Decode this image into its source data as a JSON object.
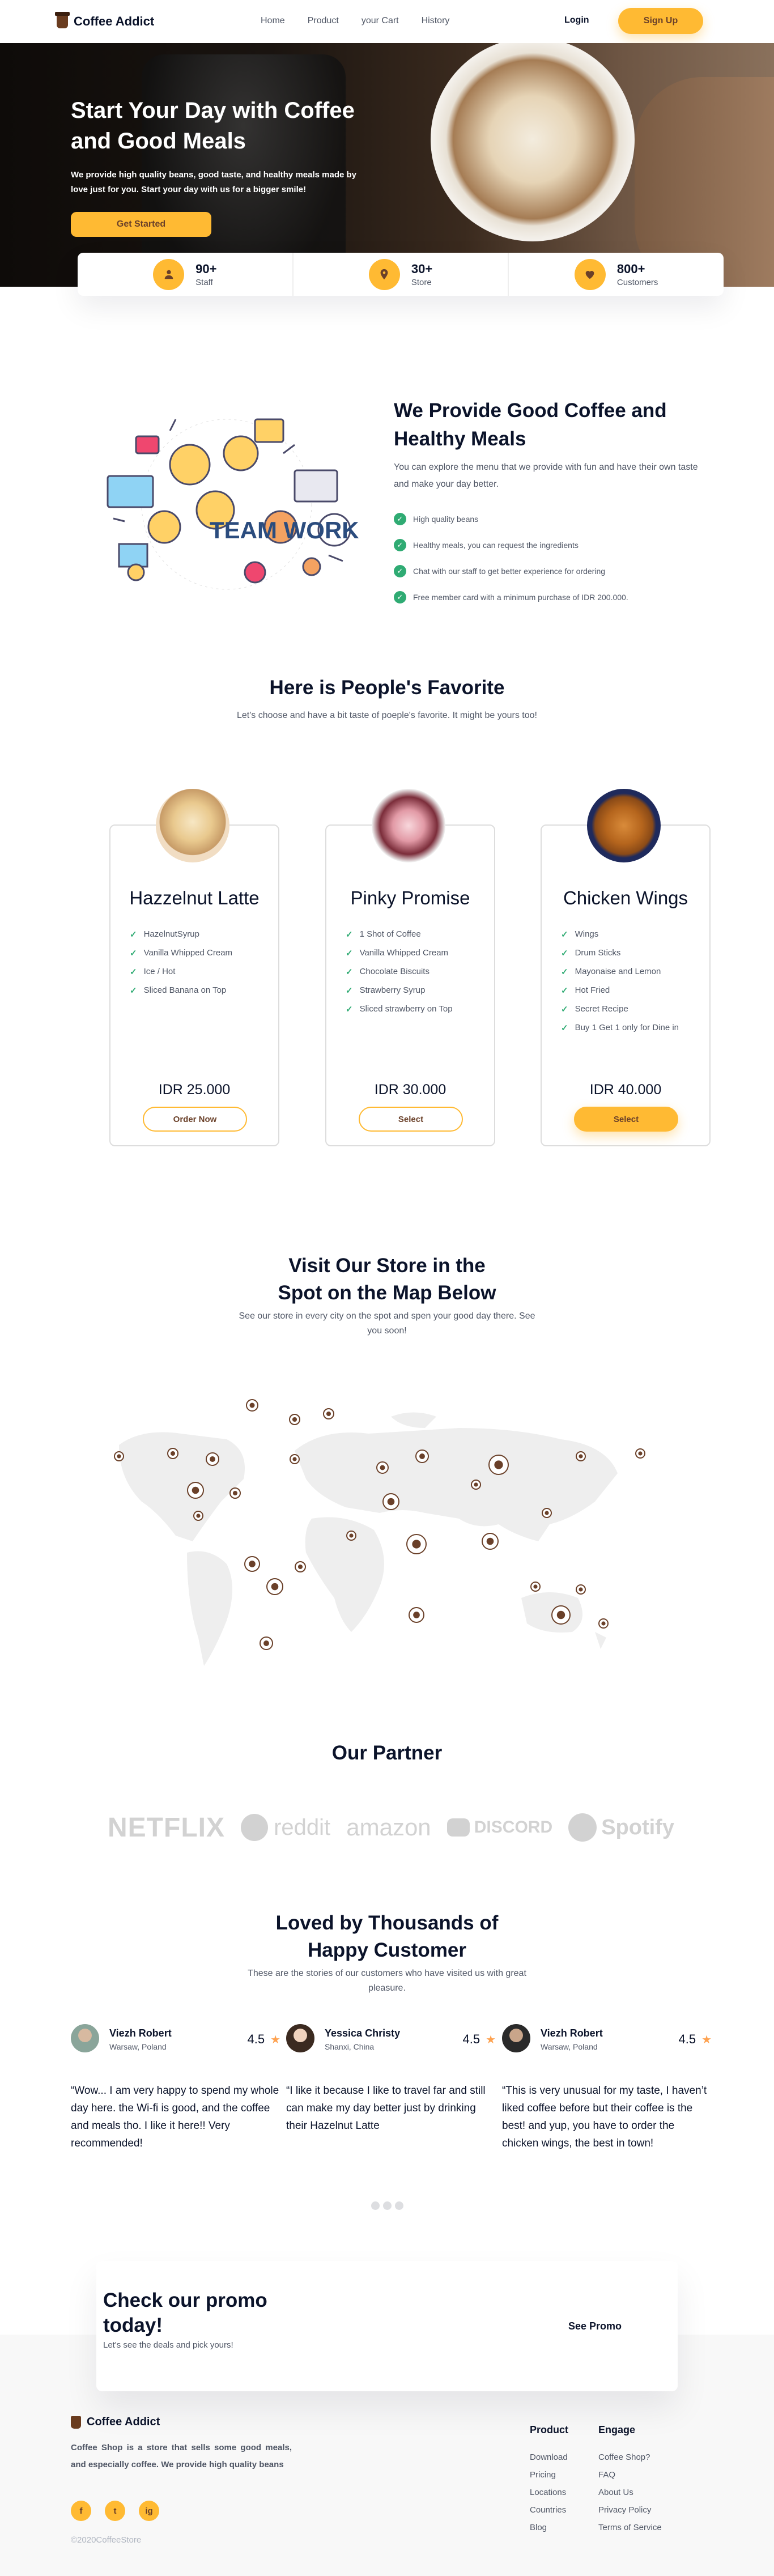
{
  "nav": {
    "brand": "Coffee Addict",
    "links": [
      "Home",
      "Product",
      "your Cart",
      "History"
    ],
    "login": "Login",
    "signup": "Sign Up"
  },
  "hero": {
    "title": "Start Your Day with Coffee and Good Meals",
    "desc": "We provide high quality beans, good taste, and healthy meals made by love just for you. Start your day with us for a bigger smile!",
    "cta": "Get Started"
  },
  "stats": [
    {
      "icon": "user-icon",
      "value": "90+",
      "label": "Staff"
    },
    {
      "icon": "location-pin-icon",
      "value": "30+",
      "label": "Store"
    },
    {
      "icon": "heart-icon",
      "value": "800+",
      "label": "Customers"
    }
  ],
  "about": {
    "illustration_text": "TEAM WORK",
    "title": "We Provide Good Coffee and Healthy Meals",
    "desc": "You can explore the menu that we provide with fun and have their own taste and make your day better.",
    "points": [
      "High quality beans",
      "Healthy meals, you can request the ingredients",
      "Chat with our staff to get better experience for ordering",
      "Free member card with a minimum purchase of IDR 200.000."
    ]
  },
  "favorites": {
    "title": "Here is People's Favorite",
    "subtitle": "Let's choose and have a bit taste of poeple's favorite. It might be yours too!",
    "items": [
      {
        "name": "Hazzelnut Latte",
        "features": [
          "HazelnutSyrup",
          "Vanilla Whipped Cream",
          "Ice / Hot",
          "Sliced Banana on Top"
        ],
        "price": "IDR 25.000",
        "button": "Order Now"
      },
      {
        "name": "Pinky Promise",
        "features": [
          "1 Shot of Coffee",
          "Vanilla Whipped Cream",
          "Chocolate Biscuits",
          "Strawberry Syrup",
          "Sliced strawberry on Top"
        ],
        "price": "IDR 30.000",
        "button": "Select"
      },
      {
        "name": "Chicken Wings",
        "features": [
          "Wings",
          "Drum Sticks",
          "Mayonaise and Lemon",
          "Hot Fried",
          "Secret Recipe",
          "Buy 1 Get 1 only for Dine in"
        ],
        "price": "IDR 40.000",
        "button": "Select"
      }
    ]
  },
  "map": {
    "title": "Visit Our Store in the Spot on the Map Below",
    "subtitle": "See our store in every city on the spot and spen your good day there. See you soon!"
  },
  "partners": {
    "title": "Our Partner",
    "logos": [
      "NETFLIX",
      "reddit",
      "amazon",
      "DISCORD",
      "Spotify"
    ]
  },
  "testimonials": {
    "title": "Loved by Thousands of Happy Customer",
    "subtitle": "These are the stories of our customers who have visited us with great pleasure.",
    "items": [
      {
        "name": "Viezh Robert",
        "location": "Warsaw, Poland",
        "rating": "4.5",
        "text": "“Wow... I am very happy to spend my whole day here. the Wi-fi is good, and the coffee and meals tho. I like it here!! Very recommended!"
      },
      {
        "name": "Yessica Christy",
        "location": "Shanxi, China",
        "rating": "4.5",
        "text": "“I like it because I like to travel far and still can make my day better just by drinking their Hazelnut Latte"
      },
      {
        "name": "Viezh Robert",
        "location": "Warsaw, Poland",
        "rating": "4.5",
        "text": "“This is very unusual for my taste, I haven’t liked coffee before but their coffee is the best! and yup, you have to order the chicken wings, the best in town!"
      }
    ]
  },
  "promo": {
    "title": "Check our promo today!",
    "subtitle": "Let's see the deals and pick yours!",
    "button": "See Promo"
  },
  "footer": {
    "brand": "Coffee Addict",
    "about": "Coffee Shop is a store that sells some good meals, and especially coffee. We provide high quality beans",
    "social": [
      "f",
      "t",
      "ig"
    ],
    "copyright": "©2020CoffeeStore",
    "product": {
      "title": "Product",
      "links": [
        "Download",
        "Pricing",
        "Locations",
        "Countries",
        "Blog"
      ]
    },
    "engage": {
      "title": "Engage",
      "links": [
        "Coffee Shop?",
        "FAQ",
        "About Us",
        "Privacy Policy",
        "Terms of Service"
      ]
    }
  },
  "colors": {
    "accent": "#ffba33",
    "brown": "#6a4029",
    "check": "#2fab73",
    "star": "#fea250"
  }
}
